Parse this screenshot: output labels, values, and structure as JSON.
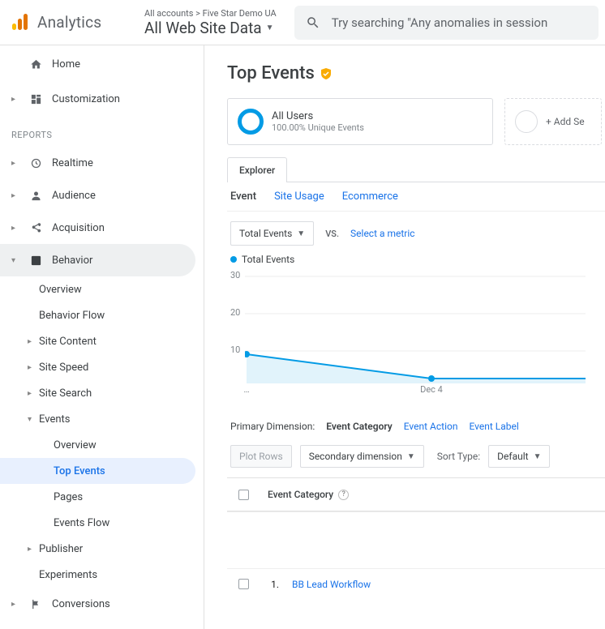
{
  "brand": "Analytics",
  "breadcrumb": "All accounts > Five Star Demo UA",
  "view_name": "All Web Site Data",
  "search_placeholder": "Try searching \"Any anomalies in session",
  "sidebar": {
    "home": "Home",
    "customization": "Customization",
    "reports_header": "REPORTS",
    "realtime": "Realtime",
    "audience": "Audience",
    "acquisition": "Acquisition",
    "behavior": "Behavior",
    "behavior_children": {
      "overview": "Overview",
      "behavior_flow": "Behavior Flow",
      "site_content": "Site Content",
      "site_speed": "Site Speed",
      "site_search": "Site Search",
      "events": "Events",
      "events_children": {
        "overview": "Overview",
        "top_events": "Top Events",
        "pages": "Pages",
        "events_flow": "Events Flow"
      },
      "publisher": "Publisher",
      "experiments": "Experiments"
    },
    "conversions": "Conversions"
  },
  "page_title": "Top Events",
  "segment": {
    "name": "All Users",
    "subtitle": "100.00% Unique Events"
  },
  "add_segment": "+ Add Se",
  "explorer_tab": "Explorer",
  "subtabs": {
    "event": "Event",
    "site_usage": "Site Usage",
    "ecommerce": "Ecommerce"
  },
  "metric_selector": "Total Events",
  "vs": "VS.",
  "select_metric": "Select a metric",
  "series_label": "Total Events",
  "yt30": "30",
  "yt20": "20",
  "yt10": "10",
  "x_ellipsis": "…",
  "x_dec4": "Dec 4",
  "chart_data": {
    "type": "line",
    "x": [
      "…",
      "Dec 4"
    ],
    "series": [
      {
        "name": "Total Events",
        "values": [
          8,
          1
        ]
      }
    ],
    "ylabel": "",
    "xlabel": "",
    "ylim": [
      0,
      30
    ]
  },
  "dim_label": "Primary Dimension:",
  "dim_event_category": "Event Category",
  "dim_event_action": "Event Action",
  "dim_event_label": "Event Label",
  "plot_rows": "Plot Rows",
  "sec_dim": "Secondary dimension",
  "sort_label": "Sort Type:",
  "sort_default": "Default",
  "col_event_category": "Event Category",
  "row1_index": "1.",
  "row1_name": "BB Lead Workflow"
}
